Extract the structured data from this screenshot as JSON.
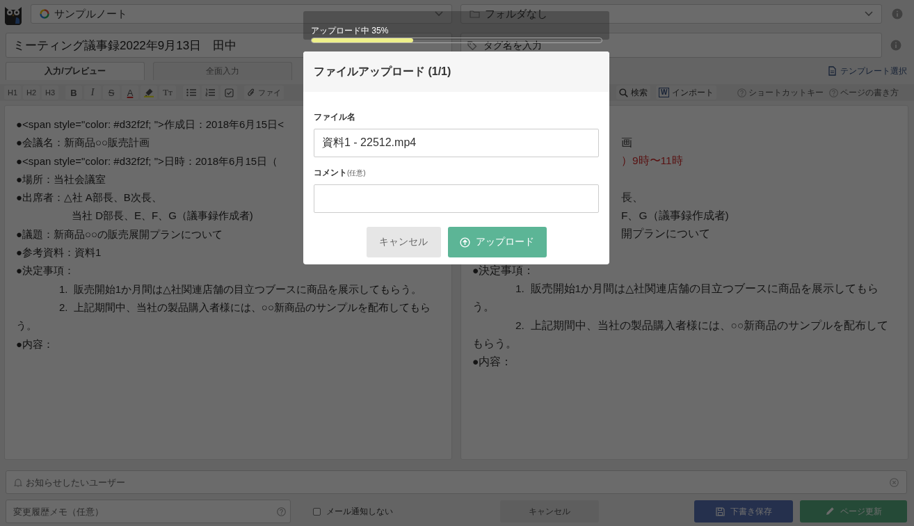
{
  "header": {
    "notebook": "サンプルノート",
    "folder": "フォルダなし",
    "title": "ミーティング議事録2022年9月13日　田中",
    "tag_placeholder": "タグ名を入力"
  },
  "tabs": [
    {
      "label": "入力/プレビュー",
      "selected": true
    },
    {
      "label": "全面入力",
      "selected": false
    }
  ],
  "template_link": "テンプレート選択",
  "toolbar": {
    "groups": [
      [
        {
          "kind": "text",
          "label": "H1"
        },
        {
          "kind": "text",
          "label": "H2"
        },
        {
          "kind": "text",
          "label": "H3"
        }
      ],
      [
        {
          "kind": "bold",
          "label": "B"
        },
        {
          "kind": "italic",
          "label": "I"
        },
        {
          "kind": "strike",
          "label": "S"
        },
        {
          "kind": "color",
          "label": "A"
        },
        {
          "kind": "highlight"
        },
        {
          "kind": "text",
          "label": "Tт"
        }
      ],
      [
        {
          "kind": "bullets"
        },
        {
          "kind": "numbers"
        },
        {
          "kind": "checklist"
        }
      ],
      [
        {
          "kind": "attach",
          "label": "ファイ"
        }
      ]
    ],
    "right": [
      {
        "kind": "search",
        "label": "検索"
      },
      {
        "kind": "word",
        "icon_text": "W",
        "label": "インポート"
      }
    ],
    "help": [
      {
        "label": "ショートカットキー"
      },
      {
        "label": "ページの書き方"
      }
    ]
  },
  "source": [
    {
      "kind": "line",
      "text": "●<span style=\"color: #d32f2f; \">作成日：2018年6月15日<"
    },
    {
      "kind": "line",
      "text": "●会議名：新商品○○販売計画"
    },
    {
      "kind": "line",
      "text": "●<span style=\"color: #d32f2f; \">日時：2018年6月15日（"
    },
    {
      "kind": "line",
      "text": "●場所：当社会議室"
    },
    {
      "kind": "line",
      "text": "●出席者：△社 A部長、B次長、"
    },
    {
      "kind": "sub",
      "text": "当社 D部長、E、F、G（議事録作成者)"
    },
    {
      "kind": "line",
      "text": "●議題：新商品○○の販売展開プランについて"
    },
    {
      "kind": "line",
      "text": "●参考資料：資料1"
    },
    {
      "kind": "line",
      "text": "●決定事項："
    },
    {
      "kind": "numbered",
      "text": "1.  販売開始1か月間は△社関連店舗の目立つブースに商品を展示してもらう。"
    },
    {
      "kind": "numbered",
      "text": "2.  上記期間中、当社の製品購入者様には、○○新商品のサンプルを配布してもらう。"
    },
    {
      "kind": "line",
      "text": "●内容："
    }
  ],
  "preview": {
    "beside_dialog": [
      {
        "lines": [
          {
            "kind": "plain",
            "text": "画"
          },
          {
            "kind": "red",
            "text": "）9時〜11時"
          }
        ]
      },
      {
        "lines": [
          {
            "kind": "plain",
            "text": "長、"
          },
          {
            "kind": "plain",
            "text": "F、G（議事録作成者)"
          },
          {
            "kind": "plain",
            "text": "開プランについて"
          }
        ]
      }
    ],
    "below_dialog": [
      {
        "kind": "line",
        "text": "●決定事項："
      },
      {
        "kind": "numbered",
        "text": "1.  販売開始1か月間は△社関連店舗の目立つブースに商品を展示してもらう。"
      },
      {
        "kind": "numbered",
        "text": "2.  上記期間中、当社の製品購入者様には、○○新商品のサンプルを配布してもらう。"
      },
      {
        "kind": "line",
        "text": "●内容："
      }
    ]
  },
  "footer": {
    "notify_placeholder": "お知らせしたいユーザー",
    "memo_placeholder": "変更履歴メモ（任意）",
    "mail_opt_out": {
      "label": "メール通知しない",
      "checked": false
    },
    "buttons": [
      {
        "kind": "cancel",
        "label": "キャンセル"
      },
      {
        "kind": "draft",
        "label": "下書き保存"
      },
      {
        "kind": "update",
        "label": "ページ更新"
      }
    ]
  },
  "upload_toast": {
    "label": "アップロード中 35%",
    "level": 0.35
  },
  "dialog": {
    "title": "ファイルアップロード (1/1)",
    "file_label": "ファイル名",
    "file_value": "資料1 - 22512.mp4",
    "comment_label": "コメント",
    "comment_hint": "(任意)",
    "buttons": [
      {
        "kind": "cancel",
        "label": "キャンセル"
      },
      {
        "kind": "upload",
        "label": "アップロード"
      }
    ]
  }
}
